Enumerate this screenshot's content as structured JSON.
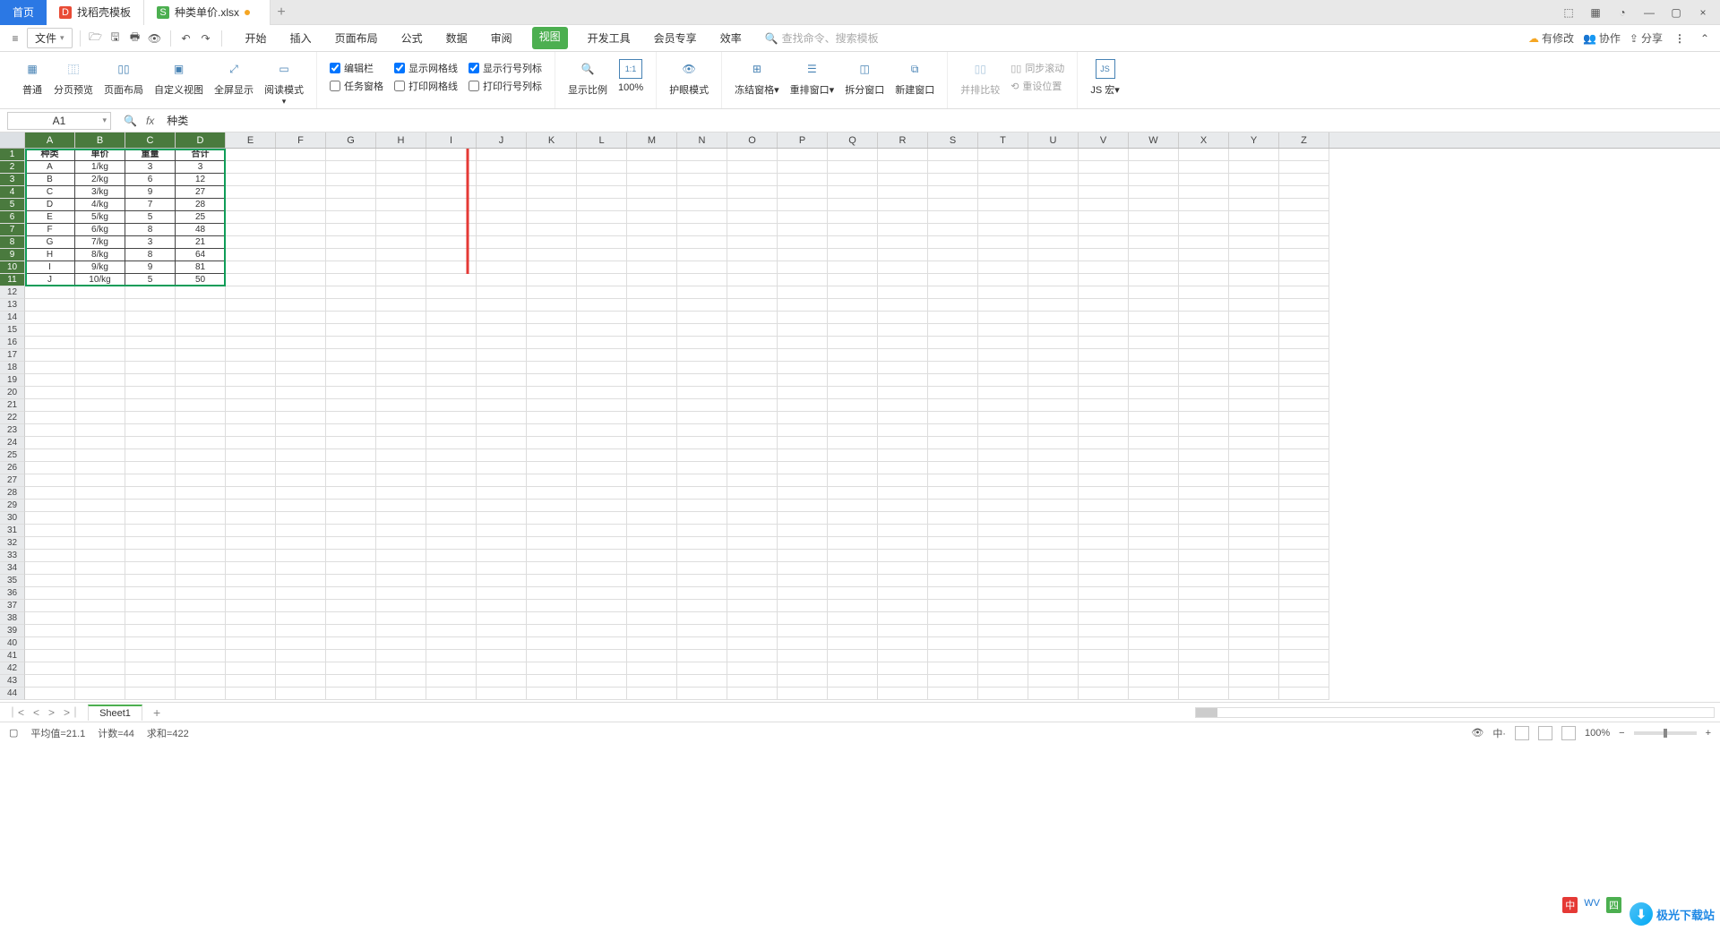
{
  "tabs": {
    "home": "首页",
    "template": "找稻壳模板",
    "doc": "种类单价.xlsx"
  },
  "window_controls": [
    "⬚",
    "▦",
    "◔",
    "—",
    "▢",
    "×"
  ],
  "file_menu": "文件",
  "menu_tabs": [
    "开始",
    "插入",
    "页面布局",
    "公式",
    "数据",
    "审阅",
    "视图",
    "开发工具",
    "会员专享",
    "效率"
  ],
  "active_menu_tab": "视图",
  "search_placeholder": "查找命令、搜索模板",
  "top_right": {
    "pending": "有修改",
    "collab": "协作",
    "share": "分享"
  },
  "ribbon": {
    "views": [
      "普通",
      "分页预览",
      "页面布局",
      "自定义视图",
      "全屏显示",
      "阅读模式"
    ],
    "checks1": {
      "editbar": "编辑栏",
      "taskpane": "任务窗格"
    },
    "checks2": {
      "gridlines": "显示网格线",
      "printgrid": "打印网格线"
    },
    "checks3": {
      "headings": "显示行号列标",
      "printhead": "打印行号列标"
    },
    "zoom": "显示比例",
    "pct100": "100%",
    "eye": "护眼模式",
    "freeze": "冻结窗格",
    "arrange": "重排窗口",
    "split": "拆分窗口",
    "newwin": "新建窗口",
    "compare": "并排比较",
    "sync": "同步滚动",
    "reset": "重设位置",
    "jsmacro": "JS 宏"
  },
  "name_box": "A1",
  "formula_value": "种类",
  "columns": [
    "A",
    "B",
    "C",
    "D",
    "E",
    "F",
    "G",
    "H",
    "I",
    "J",
    "K",
    "L",
    "M",
    "N",
    "O",
    "P",
    "Q",
    "R",
    "S",
    "T",
    "U",
    "V",
    "W",
    "X",
    "Y",
    "Z"
  ],
  "table": {
    "headers": [
      "种类",
      "单价",
      "重量",
      "合计"
    ],
    "rows": [
      [
        "A",
        "1/kg",
        "3",
        "3"
      ],
      [
        "B",
        "2/kg",
        "6",
        "12"
      ],
      [
        "C",
        "3/kg",
        "9",
        "27"
      ],
      [
        "D",
        "4/kg",
        "7",
        "28"
      ],
      [
        "E",
        "5/kg",
        "5",
        "25"
      ],
      [
        "F",
        "6/kg",
        "8",
        "48"
      ],
      [
        "G",
        "7/kg",
        "3",
        "21"
      ],
      [
        "H",
        "8/kg",
        "8",
        "64"
      ],
      [
        "I",
        "9/kg",
        "9",
        "81"
      ],
      [
        "J",
        "10/kg",
        "5",
        "50"
      ]
    ]
  },
  "sheet_name": "Sheet1",
  "status": {
    "avg": "平均值=21.1",
    "count": "计数=44",
    "sum": "求和=422",
    "zoom": "100%"
  },
  "watermark": "极光下载站",
  "ime": [
    "中",
    "WV",
    "四"
  ]
}
